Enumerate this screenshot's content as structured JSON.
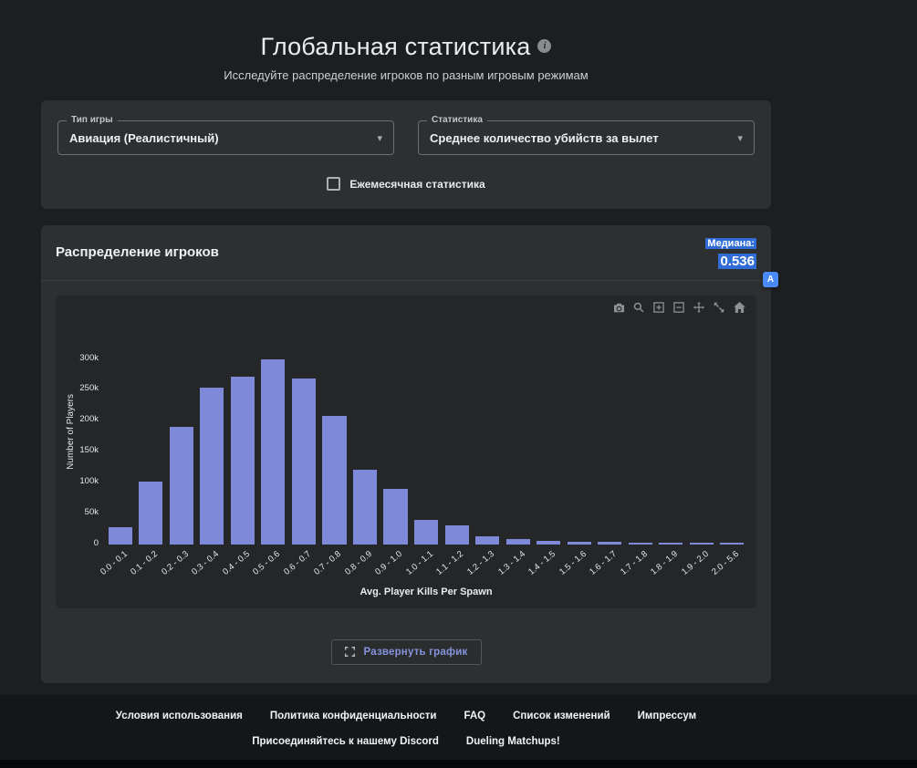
{
  "page": {
    "title": "Глобальная статистика",
    "subtitle": "Исследуйте распределение игроков по разным игровым режимам",
    "info_icon": "i"
  },
  "filters": {
    "game_type": {
      "label": "Тип игры",
      "value": "Авиация (Реалистичный)"
    },
    "statistic": {
      "label": "Статистика",
      "value": "Среднее количество убийств за вылет"
    },
    "monthly": {
      "label": "Ежемесячная статистика",
      "checked": false
    }
  },
  "chart_card": {
    "title": "Распределение игроков",
    "median_label": "Медиана:",
    "median_value": "0.536",
    "expand_button_label": "Развернуть график",
    "modebar_icons": [
      "camera-icon",
      "zoom-icon",
      "zoom-in-icon",
      "zoom-out-icon",
      "pan-icon",
      "autoscale-icon",
      "home-icon"
    ]
  },
  "chart_data": {
    "type": "bar",
    "title": "",
    "xlabel": "Avg. Player Kills Per Spawn",
    "ylabel": "Number of Players",
    "categories": [
      "0.0 - 0.1",
      "0.1 - 0.2",
      "0.2 - 0.3",
      "0.3 - 0.4",
      "0.4 - 0.5",
      "0.5 - 0.6",
      "0.6 - 0.7",
      "0.7 - 0.8",
      "0.8 - 0.9",
      "0.9 - 1.0",
      "1.0 - 1.1",
      "1.1 - 1.2",
      "1.2 - 1.3",
      "1.3 - 1.4",
      "1.4 - 1.5",
      "1.5 - 1.6",
      "1.6 - 1.7",
      "1.7 - 1.8",
      "1.8 - 1.9",
      "1.9 - 2.0",
      "2.0 - 5.6"
    ],
    "values": [
      27000,
      101000,
      190000,
      253000,
      271000,
      300000,
      268000,
      208000,
      121000,
      90000,
      39000,
      31000,
      12000,
      8000,
      5000,
      4000,
      3500,
      3000,
      2500,
      2000,
      2500
    ],
    "ylim": [
      0,
      360000
    ],
    "yticks": {
      "labels": [
        "0",
        "50k",
        "100k",
        "150k",
        "200k",
        "250k",
        "300k"
      ],
      "values": [
        0,
        50000,
        100000,
        150000,
        200000,
        250000,
        300000
      ]
    },
    "bar_color": "#7e89da",
    "plot_bg": "#242628",
    "grid": false,
    "legend": false,
    "median": 0.536
  },
  "footer": {
    "links_row1": [
      "Условия использования",
      "Политика конфиденциальности",
      "FAQ",
      "Список изменений",
      "Импрессум"
    ],
    "links_row2": [
      "Присоединяйтесь к нашему Discord",
      "Dueling Matchups!"
    ]
  },
  "colors": {
    "highlight_blue": "#2f6cd5",
    "bar": "#7e89da",
    "card_bg": "#2d2f31",
    "page_bg": "#1c1e20"
  }
}
